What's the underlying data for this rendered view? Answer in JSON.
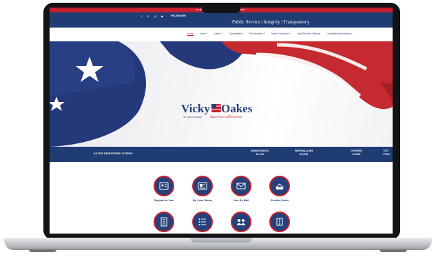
{
  "alert": {
    "left": "AN OFFICIAL UP",
    "right": "DISSION ▸"
  },
  "header": {
    "social_icons": [
      "facebook-icon",
      "x-icon",
      "instagram-icon",
      "youtube-icon"
    ],
    "social_glyphs": "f ✕ ◎ ▶",
    "phone": "904-269-6350",
    "tagline": "Public Service | Integrity | Transparency"
  },
  "nav": {
    "items": [
      "Home",
      "Voter ˅",
      "Voters ˅",
      "Candidates ˅",
      "Poll Workers ˅",
      "Voter Education ˅",
      "Local Elected Officials",
      "Candidate Information ˅"
    ]
  },
  "hero": {
    "logo_left": "Vicky",
    "logo_right": "Oakes",
    "county": "St. Johns County",
    "subtitle": "Supervisor of Elections"
  },
  "stats": {
    "label": "ACTIVE REGISTERED VOTERS",
    "items": [
      {
        "party": "DEMOCRATIC",
        "count": "42,197"
      },
      {
        "party": "REPUBLICAN",
        "count": "93,040"
      },
      {
        "party": "OTHERS",
        "count": "37,836"
      },
      {
        "party": "TOT",
        "count": "173,0"
      }
    ]
  },
  "services": [
    {
      "label": "Register to Vote",
      "icon": "id-card-icon"
    },
    {
      "label": "My Voter Status",
      "icon": "voter-card-icon"
    },
    {
      "label": "Vote By Mail",
      "icon": "envelope-icon"
    },
    {
      "label": "Election Dates",
      "icon": "calendar-icon"
    },
    {
      "label": "",
      "icon": "document-icon"
    },
    {
      "label": "",
      "icon": "checklist-icon"
    },
    {
      "label": "",
      "icon": "people-icon"
    },
    {
      "label": "",
      "icon": "building-icon"
    }
  ],
  "colors": {
    "navy": "#1f3c73",
    "red": "#c8202e",
    "white": "#ffffff"
  }
}
